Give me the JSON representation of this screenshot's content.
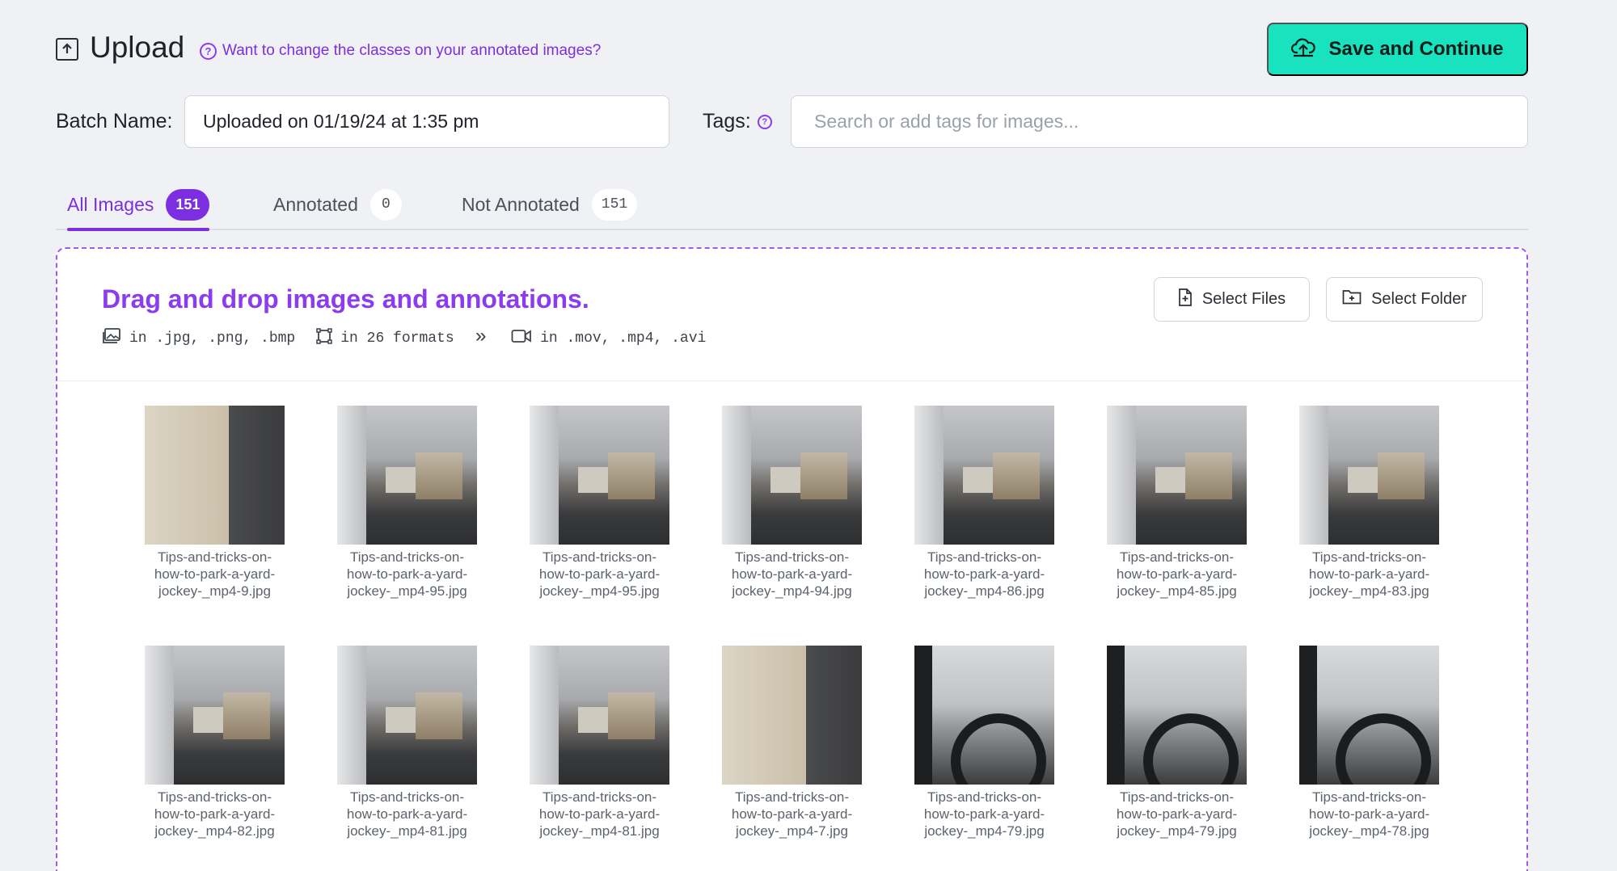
{
  "header": {
    "title": "Upload",
    "help_link": "Want to change the classes on your annotated images?",
    "save_button": "Save and Continue"
  },
  "batch": {
    "label": "Batch Name:",
    "value": "Uploaded on 01/19/24 at 1:35 pm"
  },
  "tags": {
    "label": "Tags:",
    "placeholder": "Search or add tags for images..."
  },
  "tabs": [
    {
      "label": "All Images",
      "count": "151",
      "active": true
    },
    {
      "label": "Annotated",
      "count": "0",
      "active": false
    },
    {
      "label": "Not Annotated",
      "count": "151",
      "active": false
    }
  ],
  "dropzone": {
    "title": "Drag and drop images and annotations.",
    "formats": {
      "images": "in .jpg, .png, .bmp",
      "annotations": "in 26 formats",
      "chevron": "»",
      "video": "in .mov, .mp4, .avi"
    },
    "select_files": "Select Files",
    "select_folder": "Select Folder"
  },
  "thumbnails": [
    {
      "l1": "Tips-and-tricks-on-",
      "l2": "how-to-park-a-yard-",
      "l3": "jockey-_mp4-9.jpg",
      "style": "front"
    },
    {
      "l1": "Tips-and-tricks-on-",
      "l2": "how-to-park-a-yard-",
      "l3": "jockey-_mp4-95.jpg",
      "style": "yard"
    },
    {
      "l1": "Tips-and-tricks-on-",
      "l2": "how-to-park-a-yard-",
      "l3": "jockey-_mp4-95.jpg",
      "style": "yard"
    },
    {
      "l1": "Tips-and-tricks-on-",
      "l2": "how-to-park-a-yard-",
      "l3": "jockey-_mp4-94.jpg",
      "style": "yard"
    },
    {
      "l1": "Tips-and-tricks-on-",
      "l2": "how-to-park-a-yard-",
      "l3": "jockey-_mp4-86.jpg",
      "style": "yard"
    },
    {
      "l1": "Tips-and-tricks-on-",
      "l2": "how-to-park-a-yard-",
      "l3": "jockey-_mp4-85.jpg",
      "style": "yard"
    },
    {
      "l1": "Tips-and-tricks-on-",
      "l2": "how-to-park-a-yard-",
      "l3": "jockey-_mp4-83.jpg",
      "style": "yard"
    },
    {
      "l1": "Tips-and-tricks-on-",
      "l2": "how-to-park-a-yard-",
      "l3": "jockey-_mp4-82.jpg",
      "style": "yard"
    },
    {
      "l1": "Tips-and-tricks-on-",
      "l2": "how-to-park-a-yard-",
      "l3": "jockey-_mp4-81.jpg",
      "style": "yard"
    },
    {
      "l1": "Tips-and-tricks-on-",
      "l2": "how-to-park-a-yard-",
      "l3": "jockey-_mp4-81.jpg",
      "style": "yard"
    },
    {
      "l1": "Tips-and-tricks-on-",
      "l2": "how-to-park-a-yard-",
      "l3": "jockey-_mp4-7.jpg",
      "style": "front"
    },
    {
      "l1": "Tips-and-tricks-on-",
      "l2": "how-to-park-a-yard-",
      "l3": "jockey-_mp4-79.jpg",
      "style": "cab"
    },
    {
      "l1": "Tips-and-tricks-on-",
      "l2": "how-to-park-a-yard-",
      "l3": "jockey-_mp4-79.jpg",
      "style": "cab"
    },
    {
      "l1": "Tips-and-tricks-on-",
      "l2": "how-to-park-a-yard-",
      "l3": "jockey-_mp4-78.jpg",
      "style": "cab"
    }
  ],
  "colors": {
    "accent": "#7c2fe0",
    "save_button": "#19e3be",
    "background": "#f0f1f4"
  }
}
